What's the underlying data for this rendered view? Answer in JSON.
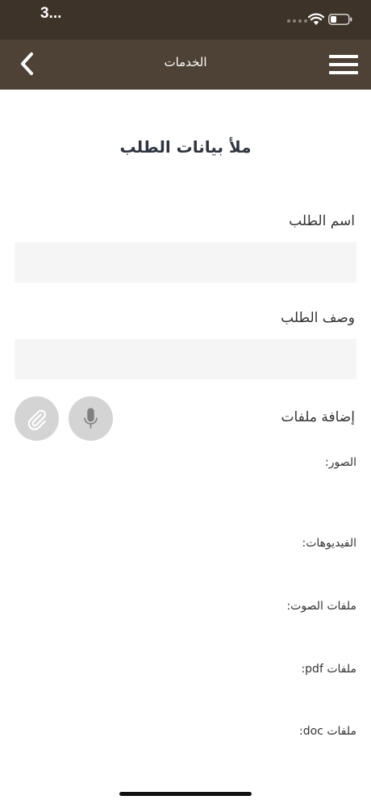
{
  "status_bar": {
    "time": "3...",
    "bar_color": "#3d3328"
  },
  "nav": {
    "title": "الخدمات",
    "back_icon": "chevron-left-icon",
    "menu_icon": "hamburger-menu-icon",
    "bar_color": "#4e4236"
  },
  "form": {
    "title": "ملأ بيانات الطلب",
    "name_label": "اسم الطلب",
    "name_value": "",
    "description_label": "وصف الطلب",
    "description_value": "",
    "add_files_label": "إضافة ملفات",
    "mic_icon": "microphone-icon",
    "attach_icon": "paperclip-icon"
  },
  "attachments": {
    "images_label": "الصور:",
    "videos_label": "الفيديوهات:",
    "audio_label": "ملفات الصوت:",
    "pdf_label": "ملفات pdf:",
    "doc_label": "ملفات doc:"
  }
}
